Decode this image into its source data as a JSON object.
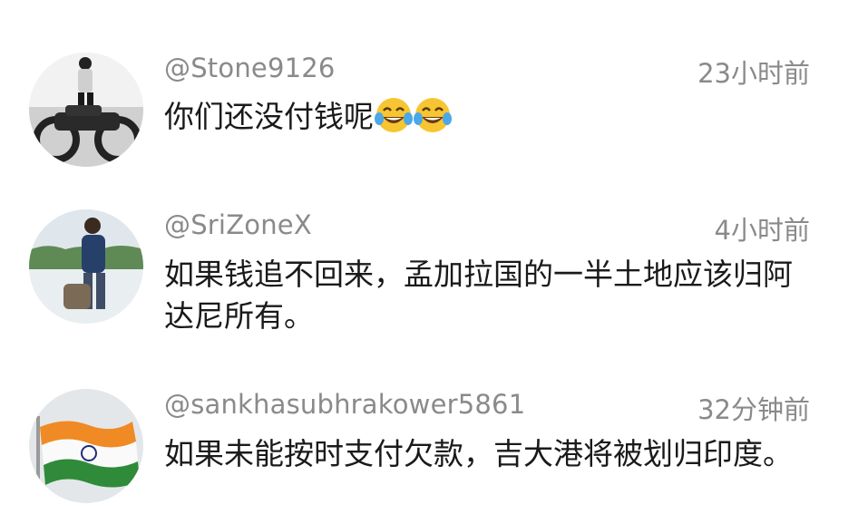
{
  "comments": [
    {
      "username": "@Stone9126",
      "time": "23小时前",
      "text": "你们还没付钱呢",
      "emojis": [
        "laughing-tears",
        "laughing-tears"
      ],
      "avatar": "motorcycle-rider-photo"
    },
    {
      "username": "@SriZoneX",
      "time": "4小时前",
      "text": "如果钱追不回来，孟加拉国的一半土地应该归阿达尼所有。",
      "avatar": "man-by-lake-photo"
    },
    {
      "username": "@sankhasubhrakower5861",
      "time": "32分钟前",
      "text": "如果未能按时支付欠款，吉大港将被划归印度。",
      "avatar": "india-flag"
    }
  ],
  "colors": {
    "meta_text": "#8a8a8a",
    "body_text": "#1a1a1a",
    "background": "#ffffff"
  }
}
